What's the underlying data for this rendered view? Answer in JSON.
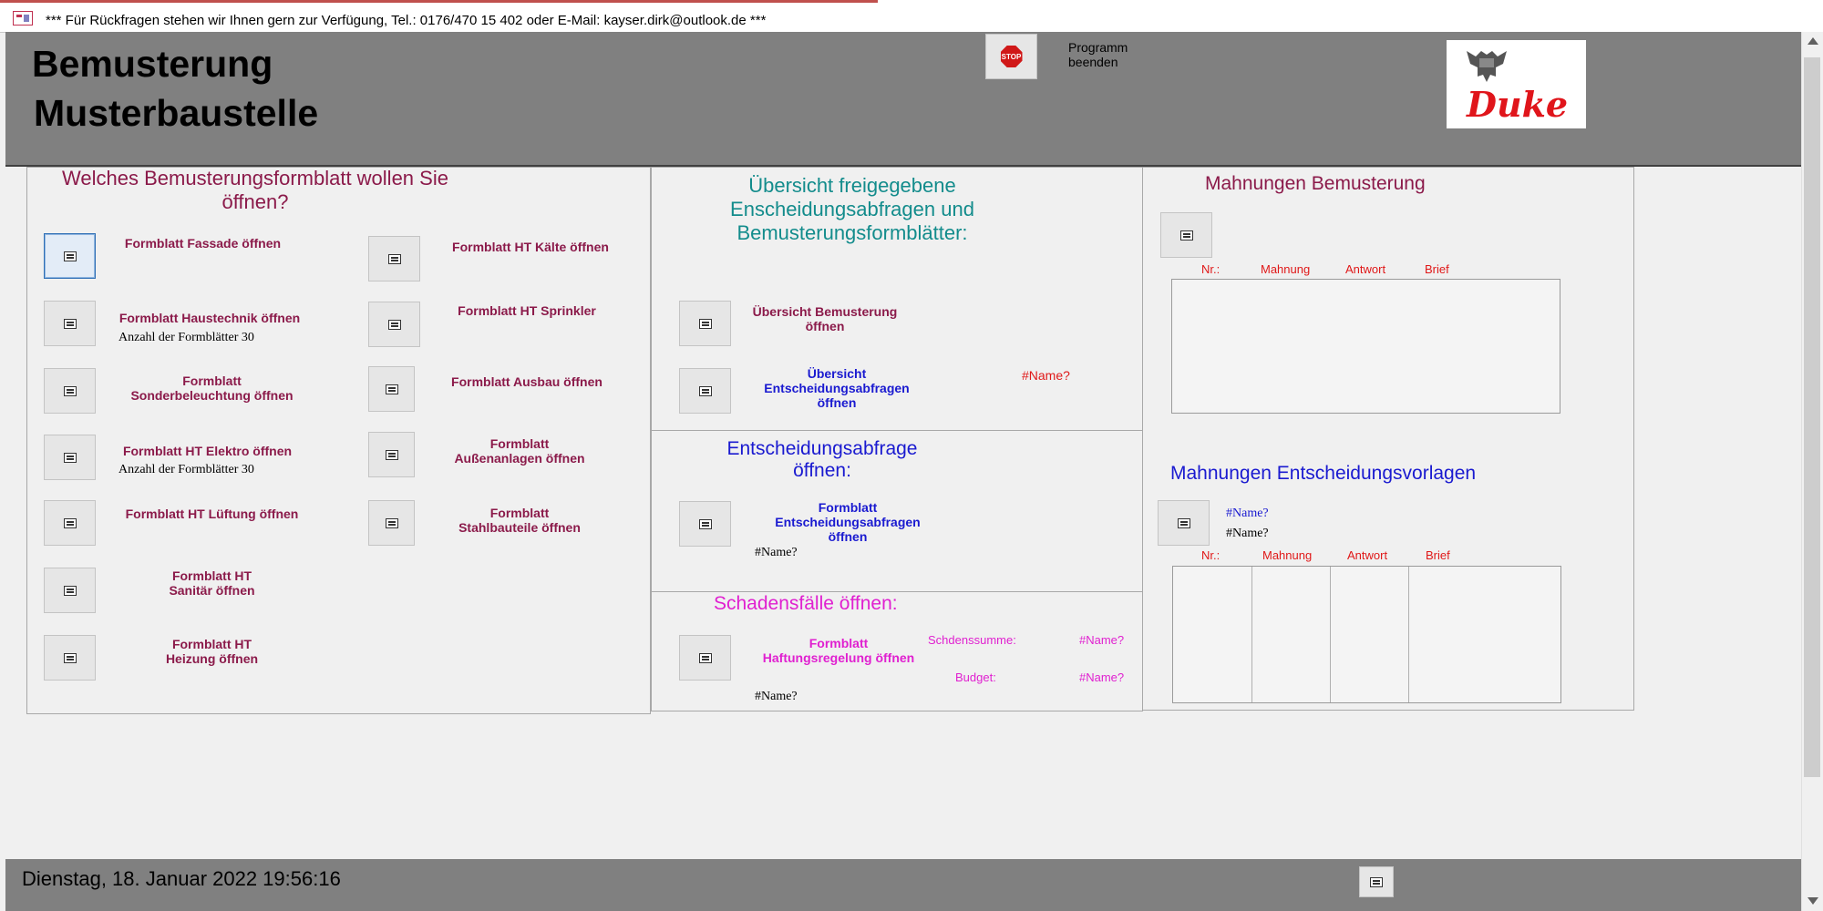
{
  "tab": {
    "text": "*** Für Rückfragen stehen wir Ihnen gern zur Verfügung, Tel.: 0176/470 15 402 oder E-Mail: kayser.dirk@outlook.de ***"
  },
  "header": {
    "title_line1": "Bemusterung",
    "title_line2": "Musterbaustelle",
    "exit_label": "Programm\nbeenden",
    "stop_text": "STOP",
    "logo_text": "Duke",
    "background": "#808080"
  },
  "left": {
    "heading": "Welches Bemusterungsformblatt wollen Sie\nöffnen?",
    "fassade": "Formblatt Fassade öffnen",
    "haustechnik": "Formblatt Haustechnik öffnen",
    "haustechnik_count": "Anzahl der Formblätter 30",
    "sonderbeleuchtung": "Formblatt\nSonderbeleuchtung öffnen",
    "elektro": "Formblatt HT Elektro öffnen",
    "elektro_count": "Anzahl der Formblätter 30",
    "lueftung": "Formblatt HT Lüftung öffnen",
    "sanitaer": "Formblatt HT\nSanitär öffnen",
    "heizung": "Formblatt HT\nHeizung öffnen",
    "kaelte": "Formblatt HT Kälte öffnen",
    "sprinkler": "Formblatt HT Sprinkler",
    "ausbau": "Formblatt Ausbau öffnen",
    "aussenanlagen": "Formblatt\nAußenanlagen öffnen",
    "stahlbauteile": "Formblatt\nStahlbauteile öffnen"
  },
  "middle": {
    "overview_heading": "Übersicht freigegebene\nEnscheidungsabfragen und\nBemusterungsformblätter:",
    "overview_bemusterung": "Übersicht Bemusterung\nöffnen",
    "overview_entscheidung": "Übersicht\nEntscheidungsabfragen\nöffnen",
    "overview_name": "#Name?",
    "entscheidung_heading": "Entscheidungsabfrage\nöffnen:",
    "entscheidung_button": "Formblatt\nEntscheidungsabfragen\nöffnen",
    "entscheidung_name": "#Name?",
    "schaden_heading": "Schadensfälle öffnen:",
    "haftung_button": "Formblatt\nHaftungsregelung öffnen",
    "schadenssumme_label": "Schdenssumme:",
    "schadenssumme_value": "#Name?",
    "budget_label": "Budget:",
    "budget_value": "#Name?",
    "haftung_name": "#Name?"
  },
  "right": {
    "mahnungen_heading": "Mahnungen Bemusterung",
    "columns": [
      "Nr.:",
      "Mahnung",
      "Antwort",
      "Brief"
    ],
    "entscheidung_heading": "Mahnungen Entscheidungsvorlagen",
    "entscheidung_name_blue": "#Name?",
    "entscheidung_name_black": "#Name?",
    "columns2": [
      "Nr.:",
      "Mahnung",
      "Antwort",
      "Brief"
    ]
  },
  "footer": {
    "datetime": "Dienstag, 18. Januar 2022 19:56:16"
  }
}
